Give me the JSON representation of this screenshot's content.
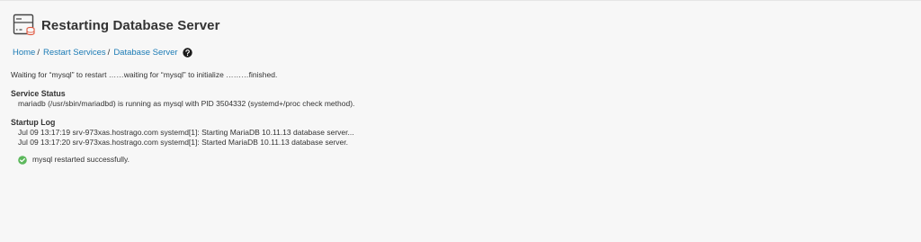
{
  "header": {
    "title": "Restarting Database Server",
    "icon": "database-server-icon"
  },
  "breadcrumb": {
    "items": [
      {
        "label": "Home"
      },
      {
        "label": "Restart Services"
      },
      {
        "label": "Database Server"
      }
    ],
    "separator": "/",
    "help_icon": "question-circle-icon"
  },
  "status": {
    "waiting_message": "Waiting for “mysql” to restart ……waiting for “mysql” to initialize ………finished."
  },
  "service_status": {
    "heading": "Service Status",
    "line": "mariadb (/usr/sbin/mariadbd) is running as mysql with PID 3504332 (systemd+/proc check method)."
  },
  "startup_log": {
    "heading": "Startup Log",
    "lines": [
      "Jul 09 13:17:19 srv-973xas.hostrago.com systemd[1]: Starting MariaDB 10.11.13 database server...",
      "Jul 09 13:17:20 srv-973xas.hostrago.com systemd[1]: Started MariaDB 10.11.13 database server."
    ]
  },
  "result": {
    "message": "mysql restarted successfully.",
    "icon": "success-check-icon",
    "color": "#5cb85c"
  },
  "colors": {
    "link": "#1b7bb5",
    "background": "#f7f7f7",
    "text": "#333333"
  }
}
